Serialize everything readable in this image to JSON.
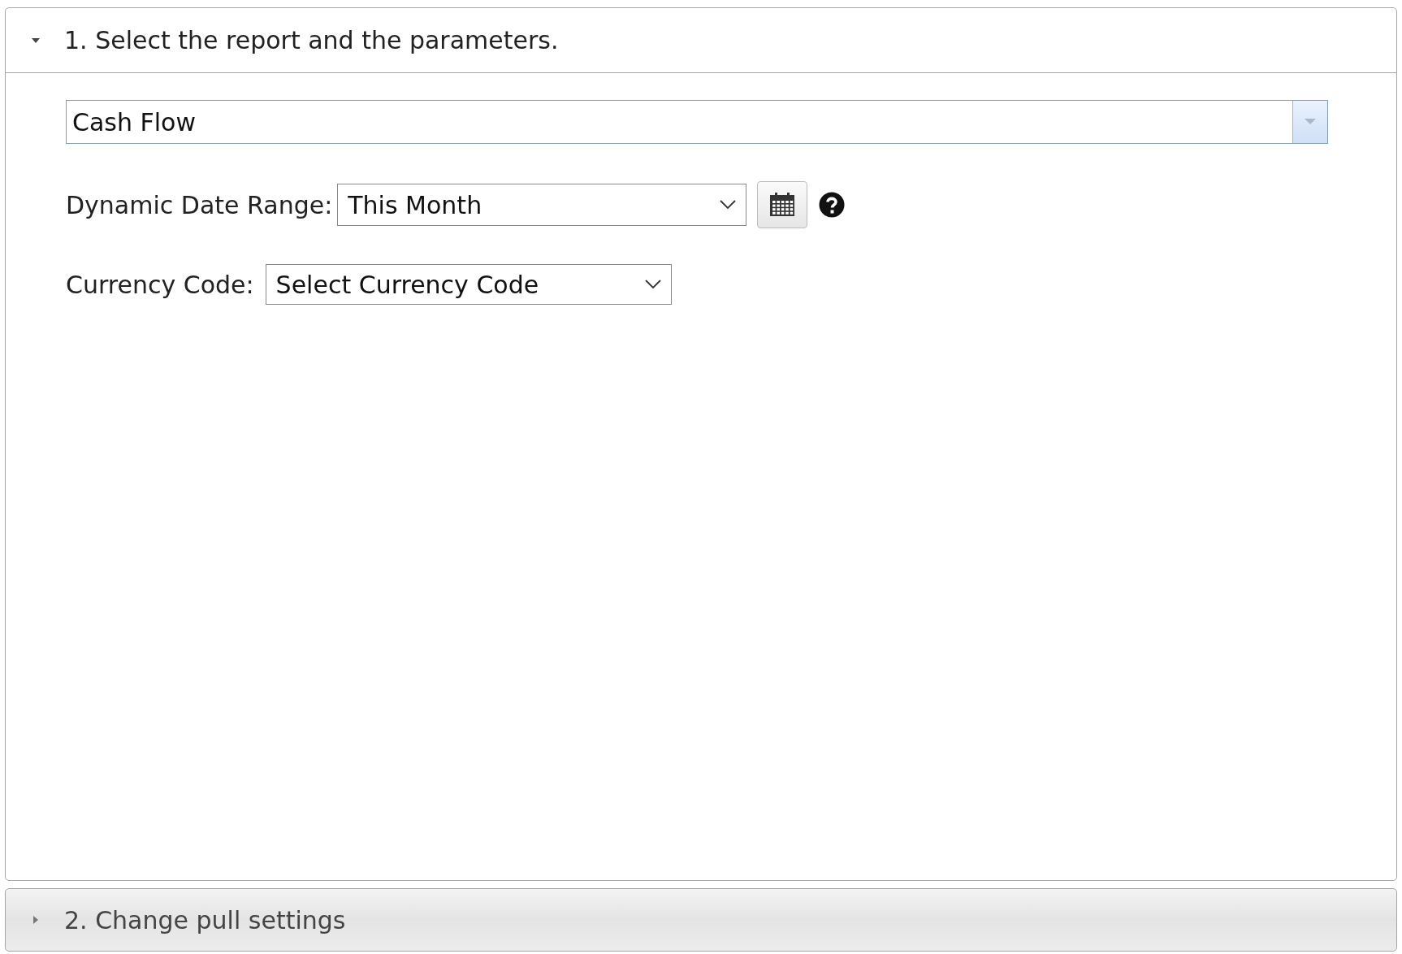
{
  "sections": [
    {
      "title": "1. Select the report and the parameters.",
      "expanded": true,
      "report_field": {
        "value": "Cash Flow"
      },
      "parameters": [
        {
          "kind": "date-range",
          "label": "Dynamic Date Range:",
          "value": "This Month"
        },
        {
          "kind": "select",
          "label": "Currency Code:",
          "value": "Select Currency Code"
        }
      ]
    },
    {
      "title": "2. Change pull settings",
      "expanded": false
    }
  ]
}
